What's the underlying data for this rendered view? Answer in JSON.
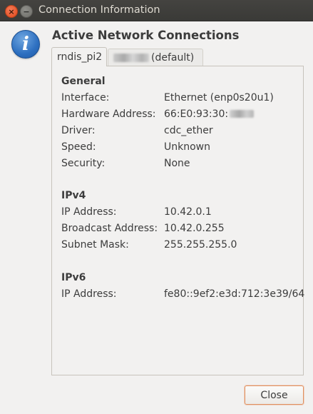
{
  "window": {
    "title": "Connection Information",
    "close_glyph": "×",
    "minimize_glyph": "−"
  },
  "dialog": {
    "heading": "Active Network Connections",
    "info_glyph": "i"
  },
  "tabs": [
    {
      "label": "rndis_pi2",
      "active": true
    },
    {
      "label": "(default)",
      "active": false
    }
  ],
  "general": {
    "title": "General",
    "rows": [
      {
        "label": "Interface:",
        "value": "Ethernet (enp0s20u1)"
      },
      {
        "label": "Hardware Address:",
        "value": "66:E0:93:30:"
      },
      {
        "label": "Driver:",
        "value": "cdc_ether"
      },
      {
        "label": "Speed:",
        "value": "Unknown"
      },
      {
        "label": "Security:",
        "value": "None"
      }
    ]
  },
  "ipv4": {
    "title": "IPv4",
    "rows": [
      {
        "label": "IP Address:",
        "value": "10.42.0.1"
      },
      {
        "label": "Broadcast Address:",
        "value": "10.42.0.255"
      },
      {
        "label": "Subnet Mask:",
        "value": "255.255.255.0"
      }
    ]
  },
  "ipv6": {
    "title": "IPv6",
    "rows": [
      {
        "label": "IP Address:",
        "value": "fe80::9ef2:e3d:712:3e39/64"
      }
    ]
  },
  "buttons": {
    "close_label": "Close"
  },
  "colors": {
    "titlebar": "#3c3b37",
    "close_button_accent": "#e0491b",
    "focus_border": "#e0905f",
    "window_bg": "#f2f1f0"
  }
}
